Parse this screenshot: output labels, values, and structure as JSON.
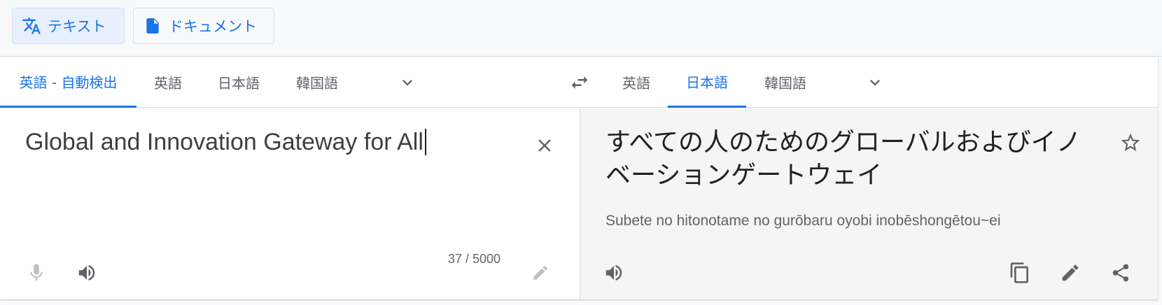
{
  "modes": {
    "text_label": "テキスト",
    "document_label": "ドキュメント"
  },
  "source_langs": [
    {
      "label": "英語 - 自動検出",
      "active": true
    },
    {
      "label": "英語",
      "active": false
    },
    {
      "label": "日本語",
      "active": false
    },
    {
      "label": "韓国語",
      "active": false
    }
  ],
  "target_langs": [
    {
      "label": "英語",
      "active": false
    },
    {
      "label": "日本語",
      "active": true
    },
    {
      "label": "韓国語",
      "active": false
    }
  ],
  "source": {
    "text": "Global and Innovation Gateway for All",
    "char_count": "37 / 5000"
  },
  "target": {
    "text": "すべての人のためのグローバルおよびイノベーションゲートウェイ",
    "transliteration": "Subete no hitonotame no gurōbaru oyobi inobēshongētou~ei"
  },
  "colors": {
    "accent": "#1a73e8",
    "icon": "#5f6368",
    "icon_disabled": "#bdc1c6"
  },
  "icons": [
    "translate-icon",
    "document-icon",
    "chevron-down-icon",
    "swap-icon",
    "close-icon",
    "mic-icon",
    "speaker-icon",
    "edit-icon",
    "star-icon",
    "copy-icon",
    "share-icon"
  ]
}
